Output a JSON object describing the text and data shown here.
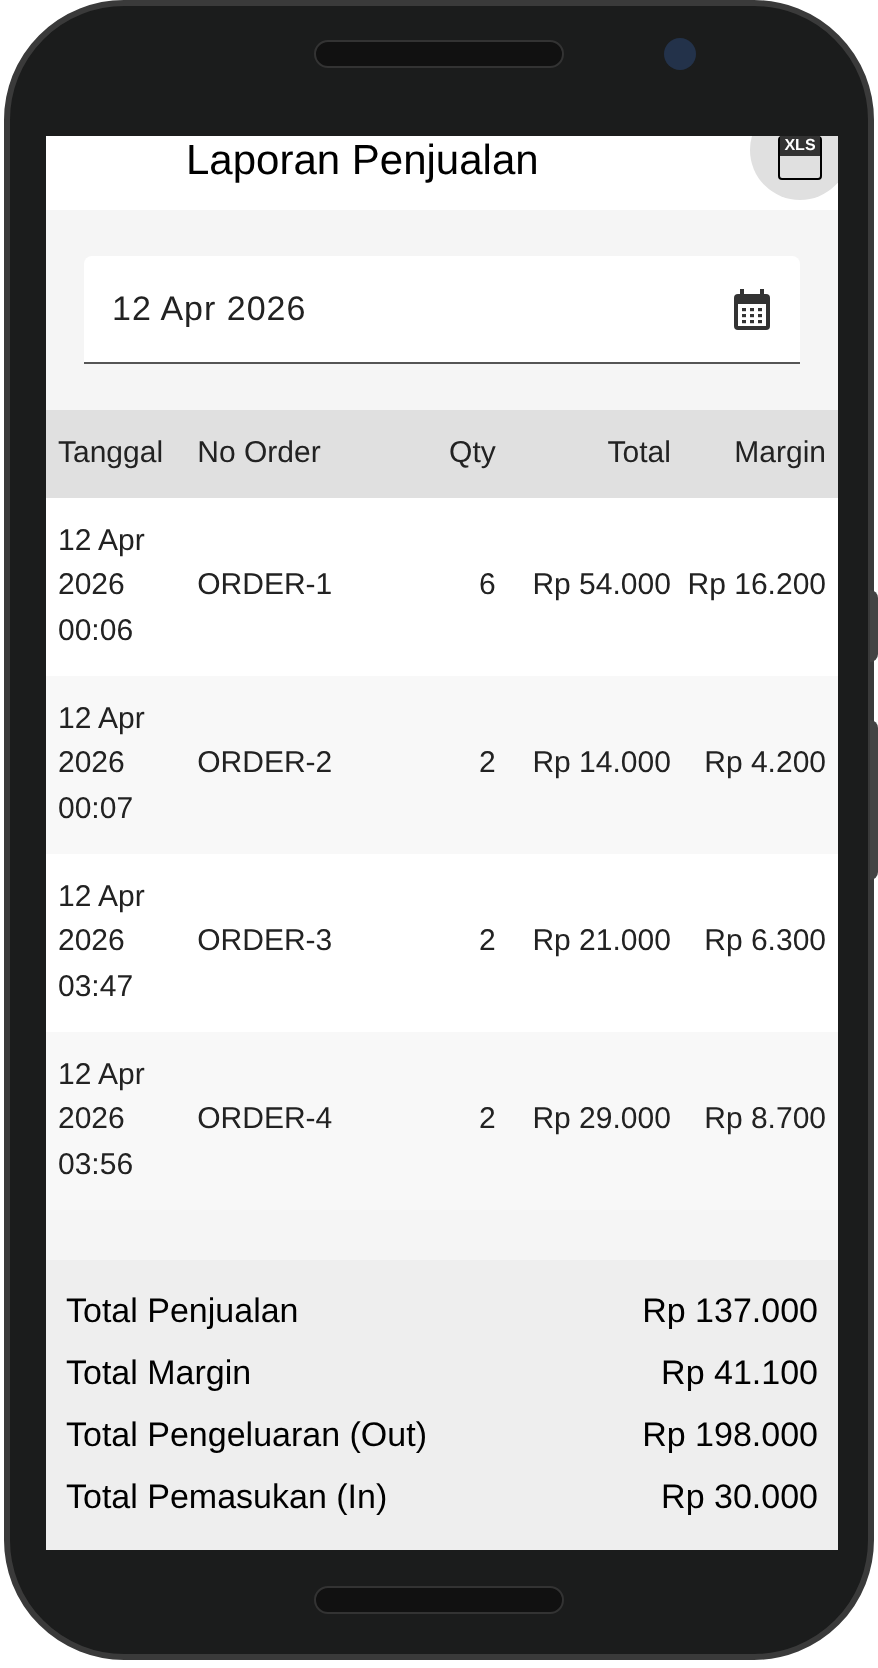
{
  "title": "Laporan Penjualan",
  "export_button": {
    "label": "XLS"
  },
  "date_field": {
    "value": "12 Apr 2026"
  },
  "table": {
    "columns": [
      "Tanggal",
      "No Order",
      "Qty",
      "Total",
      "Margin"
    ],
    "rows": [
      {
        "tanggal": "12 Apr 2026 00:06",
        "no_order": "ORDER-1",
        "qty": "6",
        "total": "Rp 54.000",
        "margin": "Rp 16.200"
      },
      {
        "tanggal": "12 Apr 2026 00:07",
        "no_order": "ORDER-2",
        "qty": "2",
        "total": "Rp 14.000",
        "margin": "Rp 4.200"
      },
      {
        "tanggal": "12 Apr 2026 03:47",
        "no_order": "ORDER-3",
        "qty": "2",
        "total": "Rp 21.000",
        "margin": "Rp 6.300"
      },
      {
        "tanggal": "12 Apr 2026 03:56",
        "no_order": "ORDER-4",
        "qty": "2",
        "total": "Rp 29.000",
        "margin": "Rp 8.700"
      }
    ]
  },
  "summary": [
    {
      "label": "Total Penjualan",
      "value": "Rp 137.000"
    },
    {
      "label": "Total Margin",
      "value": "Rp 41.100"
    },
    {
      "label": "Total Pengeluaran (Out)",
      "value": "Rp 198.000"
    },
    {
      "label": "Total Pemasukan (In)",
      "value": "Rp 30.000"
    }
  ]
}
